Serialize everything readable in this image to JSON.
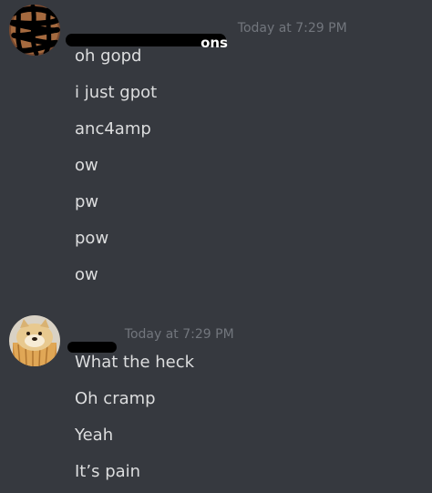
{
  "colors": {
    "background": "#36393f",
    "message_text": "#dcddde",
    "timestamp_text": "#72767d",
    "scribble": "#000000"
  },
  "messages_group_1": {
    "avatar": "scribbled-out-avatar",
    "username_visible_fragment": "ons",
    "timestamp": "Today at 7:29 PM",
    "messages": [
      "oh gopd",
      "i just gpot",
      "anc4amp",
      "ow",
      "pw",
      "pow",
      "ow"
    ]
  },
  "messages_group_2": {
    "avatar": "doge-muffin-avatar",
    "username_visible_fragment": "",
    "timestamp": "Today at 7:29 PM",
    "messages": [
      "What the heck",
      "Oh cramp",
      "Yeah",
      "It’s pain"
    ]
  }
}
